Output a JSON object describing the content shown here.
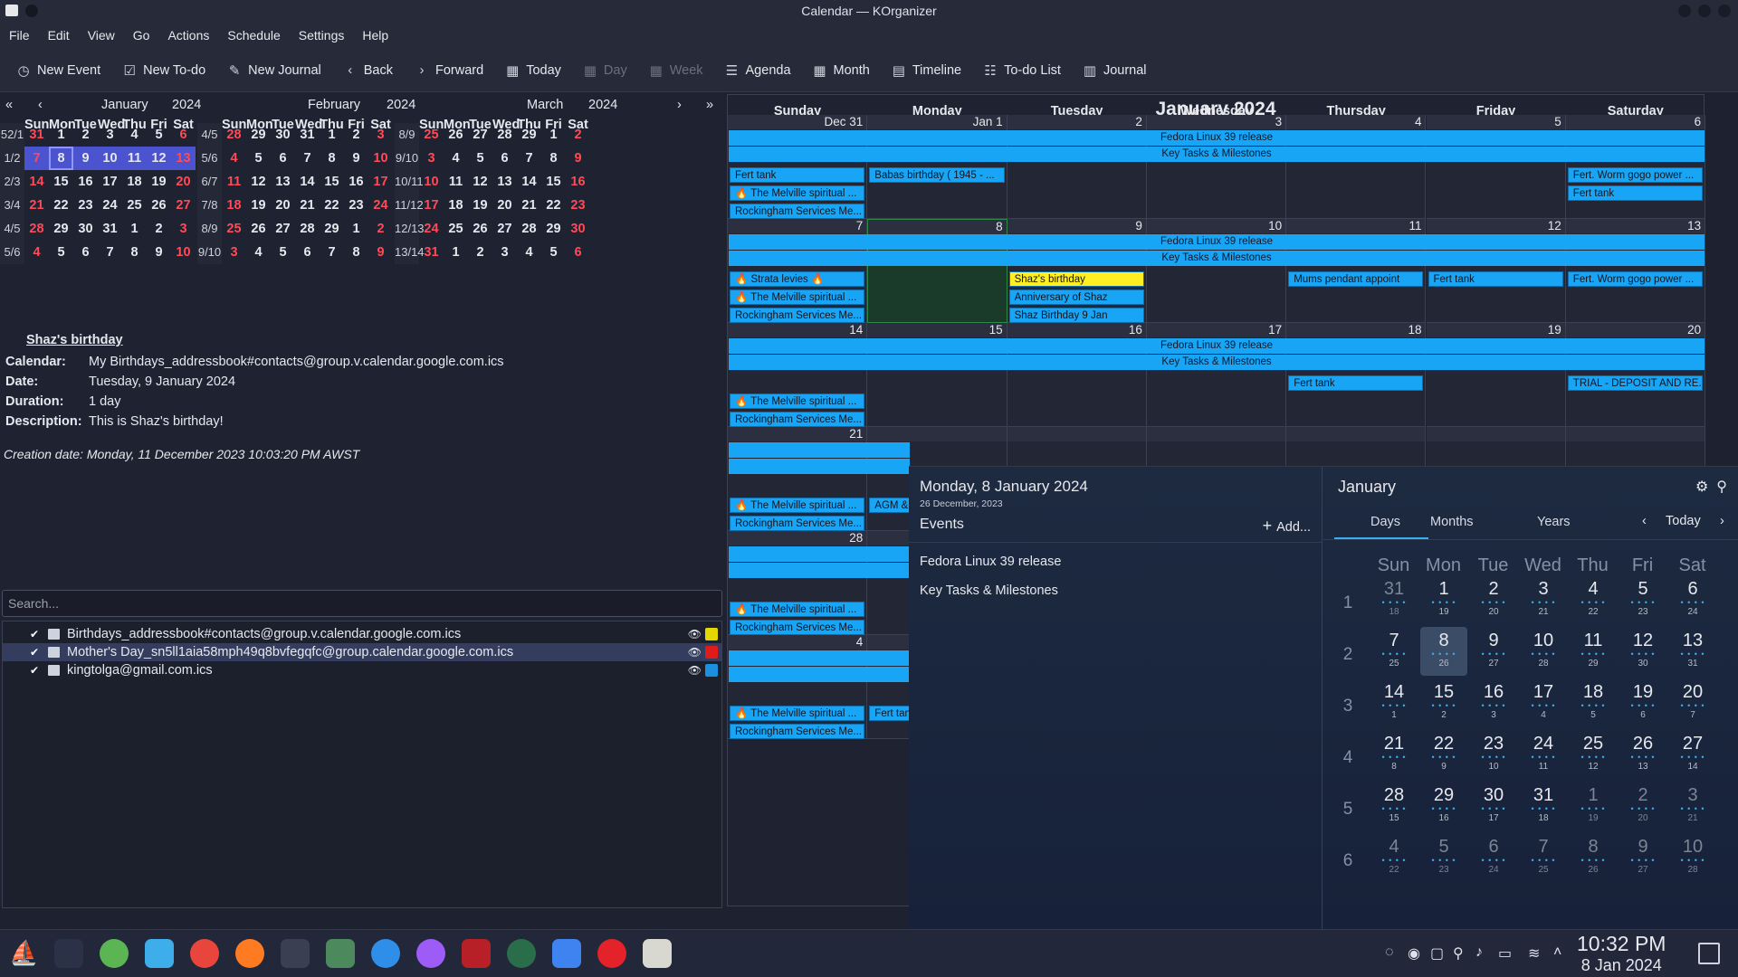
{
  "window": {
    "title": "Calendar — KOrganizer"
  },
  "menu": [
    "File",
    "Edit",
    "View",
    "Go",
    "Actions",
    "Schedule",
    "Settings",
    "Help"
  ],
  "toolbar": {
    "new_event": "New Event",
    "new_todo": "New To-do",
    "new_journal": "New Journal",
    "back": "Back",
    "forward": "Forward",
    "today": "Today",
    "day": "Day",
    "week": "Week",
    "agenda": "Agenda",
    "month": "Month",
    "timeline": "Timeline",
    "todo_list": "To-do List",
    "journal": "Journal"
  },
  "mini": {
    "months": [
      {
        "name": "January",
        "year": "2024"
      },
      {
        "name": "February",
        "year": "2024"
      },
      {
        "name": "March",
        "year": "2024"
      }
    ],
    "dow": [
      "Sun",
      "Mon",
      "Tue",
      "Wed",
      "Thu",
      "Fri",
      "Sat"
    ],
    "jan": {
      "weeks": [
        "52/1",
        "1/2",
        "2/3",
        "3/4",
        "4/5",
        "5/6"
      ],
      "rows": [
        [
          "31",
          "1",
          "2",
          "3",
          "4",
          "5",
          "6"
        ],
        [
          "7",
          "8",
          "9",
          "10",
          "11",
          "12",
          "13"
        ],
        [
          "14",
          "15",
          "16",
          "17",
          "18",
          "19",
          "20"
        ],
        [
          "21",
          "22",
          "23",
          "24",
          "25",
          "26",
          "27"
        ],
        [
          "28",
          "29",
          "30",
          "31",
          "1",
          "2",
          "3"
        ],
        [
          "4",
          "5",
          "6",
          "7",
          "8",
          "9",
          "10"
        ]
      ]
    },
    "feb": {
      "weeks": [
        "4/5",
        "5/6",
        "6/7",
        "7/8",
        "8/9",
        "9/10"
      ],
      "rows": [
        [
          "28",
          "29",
          "30",
          "31",
          "1",
          "2",
          "3"
        ],
        [
          "4",
          "5",
          "6",
          "7",
          "8",
          "9",
          "10"
        ],
        [
          "11",
          "12",
          "13",
          "14",
          "15",
          "16",
          "17"
        ],
        [
          "18",
          "19",
          "20",
          "21",
          "22",
          "23",
          "24"
        ],
        [
          "25",
          "26",
          "27",
          "28",
          "29",
          "1",
          "2"
        ],
        [
          "3",
          "4",
          "5",
          "6",
          "7",
          "8",
          "9"
        ]
      ]
    },
    "mar": {
      "weeks": [
        "8/9",
        "9/10",
        "10/11",
        "11/12",
        "12/13",
        "13/14"
      ],
      "rows": [
        [
          "25",
          "26",
          "27",
          "28",
          "29",
          "1",
          "2"
        ],
        [
          "3",
          "4",
          "5",
          "6",
          "7",
          "8",
          "9"
        ],
        [
          "10",
          "11",
          "12",
          "13",
          "14",
          "15",
          "16"
        ],
        [
          "17",
          "18",
          "19",
          "20",
          "21",
          "22",
          "23"
        ],
        [
          "24",
          "25",
          "26",
          "27",
          "28",
          "29",
          "30"
        ],
        [
          "31",
          "1",
          "2",
          "3",
          "4",
          "5",
          "6"
        ]
      ]
    }
  },
  "detail": {
    "title": "Shaz's birthday",
    "calendar_label": "Calendar:",
    "calendar": "My Birthdays_addressbook#contacts@group.v.calendar.google.com.ics",
    "date_label": "Date:",
    "date": "Tuesday, 9 January 2024",
    "duration_label": "Duration:",
    "duration": "1 day",
    "description_label": "Description:",
    "description": "This is Shaz's birthday!",
    "creation": "Creation date: Monday, 11 December 2023 10:03:20 PM AWST"
  },
  "search": {
    "placeholder": "Search..."
  },
  "calendars": [
    {
      "name": "Birthdays_addressbook#contacts@group.v.calendar.google.com.ics",
      "color": "#e6d600"
    },
    {
      "name": "Mother's Day_sn5ll1aia58mph49q8bvfegqfc@group.calendar.google.com.ics",
      "color": "#e01b1b"
    },
    {
      "name": "kingtolga@gmail.com.ics",
      "color": "#1b8fe0"
    }
  ],
  "monthview": {
    "title": "January 2024",
    "dow": [
      "Sunday",
      "Monday",
      "Tuesday",
      "Wednesday",
      "Thursday",
      "Friday",
      "Saturday"
    ],
    "day_numbers": [
      [
        "Dec 31",
        "Jan 1",
        "2",
        "3",
        "4",
        "5",
        "6"
      ],
      [
        "7",
        "8",
        "9",
        "10",
        "11",
        "12",
        "13"
      ],
      [
        "14",
        "15",
        "16",
        "17",
        "18",
        "19",
        "20"
      ],
      [
        "21",
        "",
        "",
        "",
        "",
        "",
        ""
      ],
      [
        "28",
        "",
        "",
        "",
        "",
        "",
        ""
      ],
      [
        "4",
        "",
        "",
        "",
        "",
        "",
        ""
      ]
    ],
    "bar1": "Fedora Linux 39 release",
    "bar2": "Key Tasks & Milestones",
    "events": {
      "fert_tank": "Fert tank",
      "melville": "🔥 The Melville spiritual ...",
      "rockingham": "Rockingham Services Me...",
      "babas": "Babas  birthday ( 1945 - ...",
      "worm": "Fert. Worm gogo power ...",
      "strata": "🔥    Strata levies    🔥",
      "shaz": "Shaz's birthday",
      "anniv": "Anniversary of Shaz",
      "shaz9": "Shaz Birthday 9 Jan",
      "mums": "Mums pendant appoint",
      "trial": "TRIAL - DEPOSIT AND RE...",
      "agm": "AGM &",
      "fert_tan": "Fert tan"
    }
  },
  "popup": {
    "date": "Monday, 8 January 2024",
    "sub": "26 December, 2023",
    "events_label": "Events",
    "add": "Add...",
    "events": [
      "Fedora Linux 39 release",
      "Key Tasks & Milestones"
    ],
    "month": "January",
    "tabs": [
      "Days",
      "Months",
      "Years"
    ],
    "today": "Today",
    "dow": [
      "Sun",
      "Mon",
      "Tue",
      "Wed",
      "Thu",
      "Fri",
      "Sat"
    ],
    "weeks": [
      "1",
      "2",
      "3",
      "4",
      "5",
      "6"
    ],
    "days": [
      [
        "31",
        "1",
        "2",
        "3",
        "4",
        "5",
        "6"
      ],
      [
        "7",
        "8",
        "9",
        "10",
        "11",
        "12",
        "13"
      ],
      [
        "14",
        "15",
        "16",
        "17",
        "18",
        "19",
        "20"
      ],
      [
        "21",
        "22",
        "23",
        "24",
        "25",
        "26",
        "27"
      ],
      [
        "28",
        "29",
        "30",
        "31",
        "1",
        "2",
        "3"
      ],
      [
        "4",
        "5",
        "6",
        "7",
        "8",
        "9",
        "10"
      ]
    ],
    "subs": [
      [
        "18",
        "19",
        "20",
        "21",
        "22",
        "23",
        "24"
      ],
      [
        "25",
        "26",
        "27",
        "28",
        "29",
        "30",
        "31"
      ],
      [
        "1",
        "2",
        "3",
        "4",
        "5",
        "6",
        "7"
      ],
      [
        "8",
        "9",
        "10",
        "11",
        "12",
        "13",
        "14"
      ],
      [
        "15",
        "16",
        "17",
        "18",
        "19",
        "20",
        "21"
      ],
      [
        "22",
        "23",
        "24",
        "25",
        "26",
        "27",
        "28"
      ]
    ]
  },
  "clock": {
    "time": "10:32 PM",
    "date": "8 Jan 2024"
  },
  "colors": {
    "accent": "#18a5f5",
    "selection": "#4b54ce",
    "weekend": "#ff4a57",
    "highlight": "#ffee22"
  }
}
